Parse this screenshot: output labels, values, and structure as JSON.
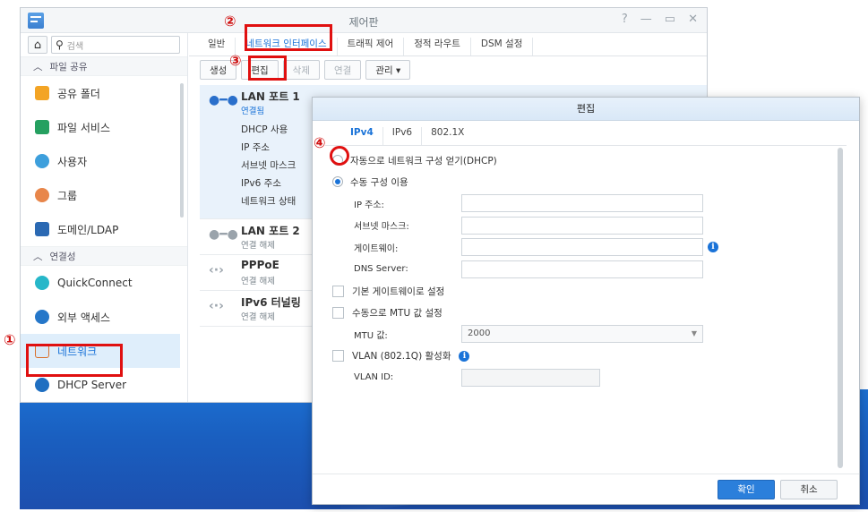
{
  "window": {
    "title": "제어판",
    "controls": [
      "?",
      "—",
      "▭",
      "✕"
    ]
  },
  "sidebar": {
    "search_placeholder": "검색",
    "section1": "파일 공유",
    "items1": [
      "공유 폴더",
      "파일 서비스",
      "사용자",
      "그룹",
      "도메인/LDAP"
    ],
    "section2": "연결성",
    "items2": [
      "QuickConnect",
      "외부 액세스",
      "네트워크",
      "DHCP Server"
    ]
  },
  "tabs": [
    "일반",
    "네트워크 인터페이스",
    "트래픽 제어",
    "정적 라우트",
    "DSM 설정"
  ],
  "toolbar": {
    "create": "생성",
    "edit": "편집",
    "delete": "삭제",
    "connect": "연결",
    "manage": "관리 ▾"
  },
  "ports": [
    {
      "name": "LAN 포트 1",
      "status": "연결됨",
      "details": [
        "DHCP 사용",
        "IP 주소",
        "서브넷 마스크",
        "IPv6 주소",
        "네트워크 상태"
      ]
    },
    {
      "name": "LAN 포트 2",
      "status": "연결 해제"
    },
    {
      "name": "PPPoE",
      "status": "연결 해제"
    },
    {
      "name": "IPv6 터널링",
      "status": "연결 해제"
    }
  ],
  "dialog": {
    "title": "편집",
    "tabs": [
      "IPv4",
      "IPv6",
      "802.1X"
    ],
    "radio_dhcp": "자동으로 네트워크 구성 얻기(DHCP)",
    "radio_manual": "수동 구성 이용",
    "ip_label": "IP 주소:",
    "subnet_label": "서브넷 마스크:",
    "gateway_label": "게이트웨이:",
    "dns_label": "DNS Server:",
    "default_gateway": "기본 게이트웨이로 설정",
    "manual_mtu": "수동으로 MTU 값 설정",
    "mtu_label": "MTU 값:",
    "mtu_value": "2000",
    "vlan": "VLAN (802.1Q) 활성화",
    "vlan_id_label": "VLAN ID:",
    "ok": "확인",
    "cancel": "취소"
  },
  "annotations": {
    "step1": "①",
    "step2": "②",
    "step3": "③",
    "step4": "④"
  },
  "colors": {
    "highlight": "#e01010",
    "accent": "#1a73d8"
  }
}
